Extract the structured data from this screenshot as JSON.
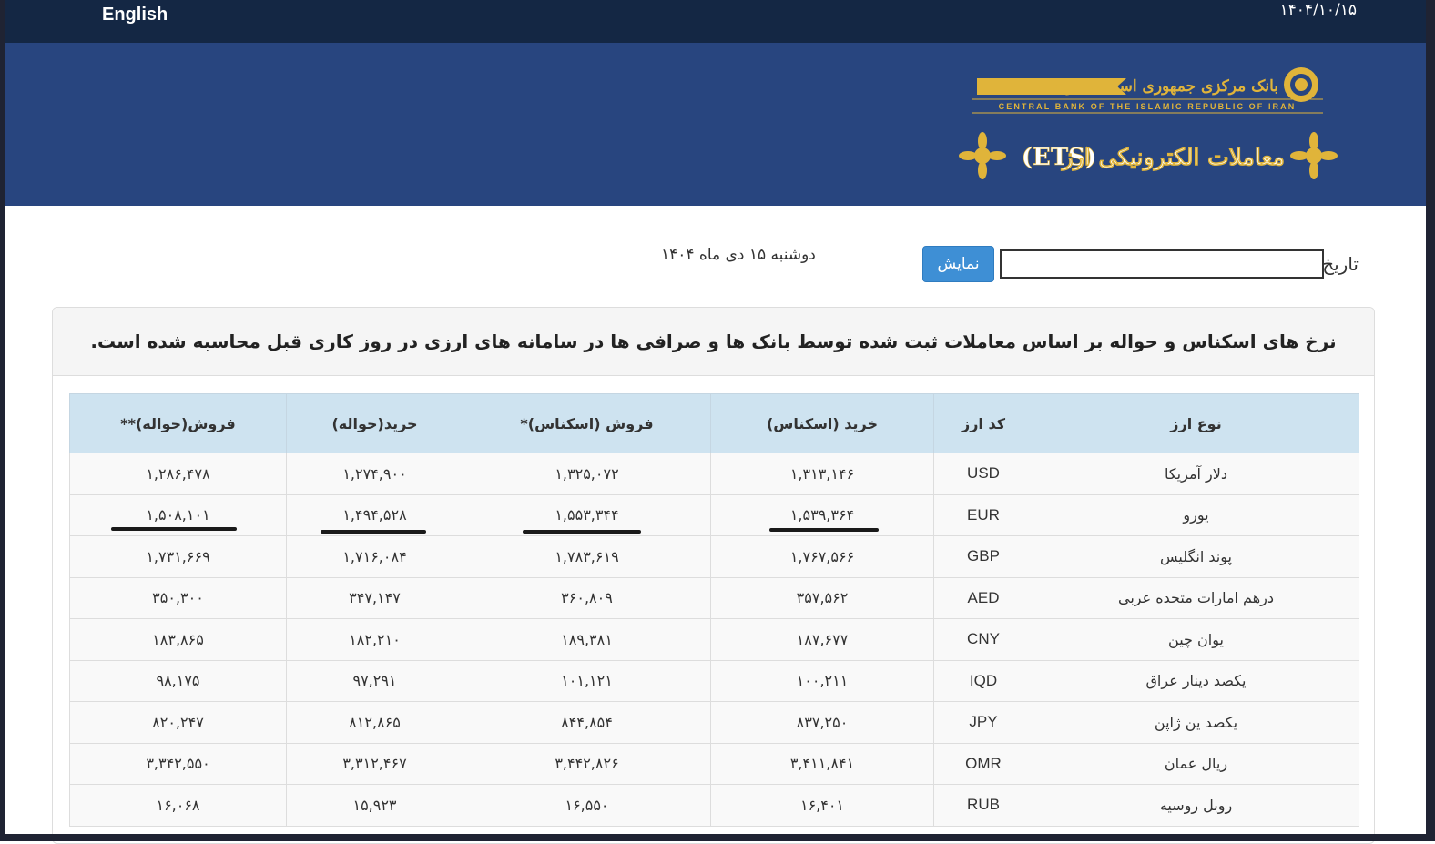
{
  "topbar": {
    "language_link": "English",
    "date": "۱۴۰۴/۱۰/۱۵"
  },
  "banner": {
    "bank_name_fa": "بانک مرکزی جمهوری اسلامی ایران",
    "bank_name_en": "CENTRAL BANK OF THE ISLAMIC REPUBLIC OF IRAN",
    "system_title": "معاملات الکترونیکی ارز",
    "system_abbr": "(ETS)"
  },
  "filter": {
    "date_label": "تاریخ:",
    "date_value": "",
    "show_button": "نمایش",
    "current_date": "دوشنبه ۱۵ دی ماه ۱۴۰۴"
  },
  "panel": {
    "heading": "نرخ های اسکناس و حواله بر اساس معاملات ثبت شده توسط بانک ها و صرافی ها در سامانه های ارزی در روز کاری قبل محاسبه شده است."
  },
  "table": {
    "headers": [
      "نوع ارز",
      "کد ارز",
      "خرید (اسکناس)",
      "فروش (اسکناس)*",
      "خرید(حواله)",
      "فروش(حواله)**"
    ],
    "rows": [
      {
        "name": "دلار آمریکا",
        "code": "USD",
        "buy_cash": "۱,۳۱۳,۱۴۶",
        "sell_cash": "۱,۳۲۵,۰۷۲",
        "buy_transfer": "۱,۲۷۴,۹۰۰",
        "sell_transfer": "۱,۲۸۶,۴۷۸"
      },
      {
        "name": "یورو",
        "code": "EUR",
        "buy_cash": "۱,۵۳۹,۳۶۴",
        "sell_cash": "۱,۵۵۳,۳۴۴",
        "buy_transfer": "۱,۴۹۴,۵۲۸",
        "sell_transfer": "۱,۵۰۸,۱۰۱"
      },
      {
        "name": "پوند انگلیس",
        "code": "GBP",
        "buy_cash": "۱,۷۶۷,۵۶۶",
        "sell_cash": "۱,۷۸۳,۶۱۹",
        "buy_transfer": "۱,۷۱۶,۰۸۴",
        "sell_transfer": "۱,۷۳۱,۶۶۹"
      },
      {
        "name": "درهم امارات متحده عربی",
        "code": "AED",
        "buy_cash": "۳۵۷,۵۶۲",
        "sell_cash": "۳۶۰,۸۰۹",
        "buy_transfer": "۳۴۷,۱۴۷",
        "sell_transfer": "۳۵۰,۳۰۰"
      },
      {
        "name": "یوان چین",
        "code": "CNY",
        "buy_cash": "۱۸۷,۶۷۷",
        "sell_cash": "۱۸۹,۳۸۱",
        "buy_transfer": "۱۸۲,۲۱۰",
        "sell_transfer": "۱۸۳,۸۶۵"
      },
      {
        "name": "یکصد دینار عراق",
        "code": "IQD",
        "buy_cash": "۱۰۰,۲۱۱",
        "sell_cash": "۱۰۱,۱۲۱",
        "buy_transfer": "۹۷,۲۹۱",
        "sell_transfer": "۹۸,۱۷۵"
      },
      {
        "name": "یکصد ین ژاپن",
        "code": "JPY",
        "buy_cash": "۸۳۷,۲۵۰",
        "sell_cash": "۸۴۴,۸۵۴",
        "buy_transfer": "۸۱۲,۸۶۵",
        "sell_transfer": "۸۲۰,۲۴۷"
      },
      {
        "name": "ریال عمان",
        "code": "OMR",
        "buy_cash": "۳,۴۱۱,۸۴۱",
        "sell_cash": "۳,۴۴۲,۸۲۶",
        "buy_transfer": "۳,۳۱۲,۴۶۷",
        "sell_transfer": "۳,۳۴۲,۵۵۰"
      },
      {
        "name": "روبل روسیه",
        "code": "RUB",
        "buy_cash": "۱۶,۴۰۱",
        "sell_cash": "۱۶,۵۵۰",
        "buy_transfer": "۱۵,۹۲۳",
        "sell_transfer": "۱۶,۰۶۸"
      }
    ]
  },
  "colors": {
    "topbar": "#142744",
    "banner": "#28457f",
    "gold": "#e0b43a",
    "button": "#3e8fd5",
    "table_header": "#cee3f0"
  }
}
